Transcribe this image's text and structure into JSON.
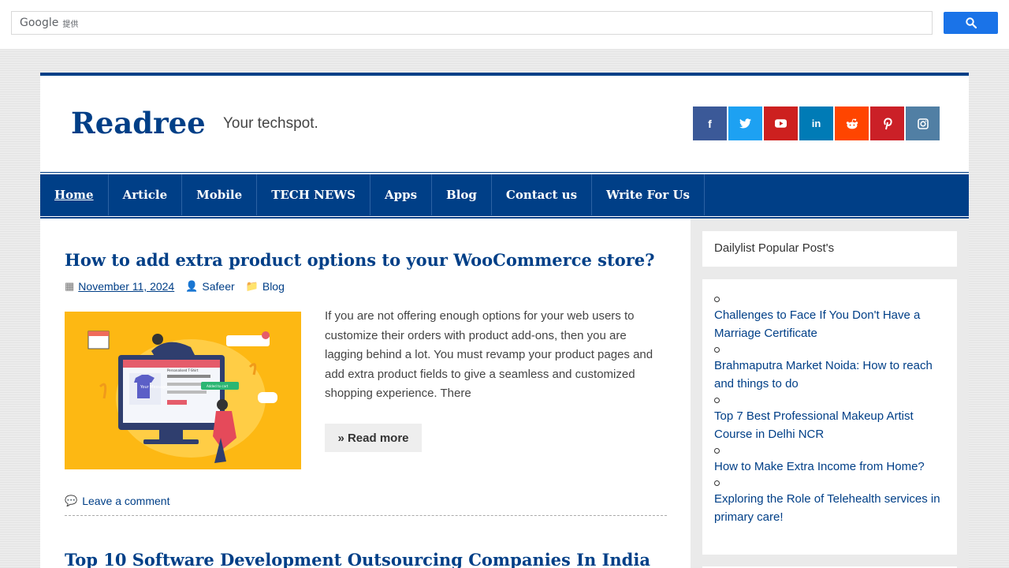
{
  "google_bar": {
    "brand": "Google",
    "brand_sub": "提供"
  },
  "site": {
    "title": "Readree",
    "tagline": "Your techspot."
  },
  "socials": [
    {
      "icon": "facebook-icon",
      "glyph": "f",
      "color": "#3b5998"
    },
    {
      "icon": "twitter-icon",
      "glyph": "🐦",
      "color": "#1da1f2"
    },
    {
      "icon": "youtube-icon",
      "glyph": "▶",
      "color": "#cd201f"
    },
    {
      "icon": "linkedin-icon",
      "glyph": "in",
      "color": "#007bb6"
    },
    {
      "icon": "reddit-icon",
      "glyph": "👽",
      "color": "#ff4500"
    },
    {
      "icon": "pinterest-icon",
      "glyph": "P",
      "color": "#cb2027"
    },
    {
      "icon": "instagram-icon",
      "glyph": "◎",
      "color": "#517fa4"
    }
  ],
  "nav": {
    "items": [
      "Home",
      "Article",
      "Mobile",
      "TECH NEWS",
      "Apps",
      "Blog",
      "Contact us",
      "Write For Us"
    ]
  },
  "post": {
    "title": "How to add extra product options to your WooCommerce store?",
    "date": "November 11, 2024",
    "author": "Safeer",
    "category": "Blog",
    "excerpt": "If you are not offering enough options for your web users to customize their orders with product add-ons, then you are lagging behind a lot. You must revamp your product pages and add extra product fields to give a seamless and customized shopping experience.  There",
    "read_more": "» Read more",
    "comment": "Leave a comment",
    "thumb_texts": {
      "panel_title": "Personalised T-Shirt",
      "shirt_text": "Your Message",
      "added_badge": "Added to cart"
    }
  },
  "next_post": {
    "title": "Top 10 Software Development Outsourcing Companies In India"
  },
  "sidebar": {
    "widget_title": "Dailylist Popular Post's",
    "items": [
      "Challenges to Face If You Don't Have a Marriage Certificate",
      "Brahmaputra Market Noida: How to reach and things to do",
      "Top 7 Best Professional Makeup Artist Course in Delhi NCR",
      "How to Make Extra Income from Home?",
      "Exploring the Role of Telehealth services in primary care!"
    ]
  },
  "colors": {
    "primary": "#003f87",
    "search_button": "#1a73e8"
  }
}
